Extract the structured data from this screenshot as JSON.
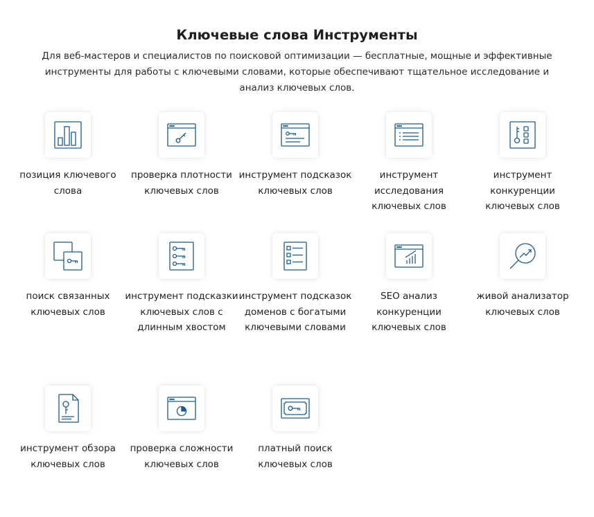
{
  "header": {
    "title": "Ключевые слова Инструменты",
    "description": "Для веб-мастеров и специалистов по поисковой оптимизации — бесплатные, мощные и эффективные инструменты для работы с ключевыми словами, которые обеспечивают тщательное исследование и анализ ключевых слов."
  },
  "colors": {
    "icon_stroke": "#1e5a8c",
    "text": "#222222"
  },
  "tools": [
    {
      "id": "keyword-position",
      "icon": "bar-chart-icon",
      "label": "позиция ключевого слова"
    },
    {
      "id": "keyword-density",
      "icon": "browser-key-icon",
      "label": "проверка плотности ключевых слов"
    },
    {
      "id": "keyword-suggestion",
      "icon": "browser-key-list-icon",
      "label": "инструмент подсказок ключевых слов"
    },
    {
      "id": "keyword-research",
      "icon": "browser-list-icon",
      "label": "инструмент исследования ключевых слов"
    },
    {
      "id": "keyword-competition",
      "icon": "key-grid-icon",
      "label": "инструмент конкуренции ключевых слов"
    },
    {
      "id": "related-keywords",
      "icon": "overlap-key-icon",
      "label": "поиск связанных ключевых слов"
    },
    {
      "id": "long-tail",
      "icon": "keys-list-icon",
      "label": "инструмент подсказки ключевых слов с длинным хвостом"
    },
    {
      "id": "domain-suggestion",
      "icon": "checklist-icon",
      "label": "инструмент подсказок доменов с богатыми ключевыми словами"
    },
    {
      "id": "seo-competition",
      "icon": "browser-growth-icon",
      "label": "SEO анализ конкуренции ключевых слов"
    },
    {
      "id": "live-analyzer",
      "icon": "magnifier-trend-icon",
      "label": "живой анализатор ключевых слов"
    },
    {
      "id": "keyword-overview",
      "icon": "document-key-icon",
      "label": "инструмент обзора ключевых слов"
    },
    {
      "id": "keyword-difficulty",
      "icon": "browser-pie-icon",
      "label": "проверка сложности ключевых слов"
    },
    {
      "id": "paid-search",
      "icon": "ticket-key-icon",
      "label": "платный поиск ключевых слов"
    }
  ]
}
